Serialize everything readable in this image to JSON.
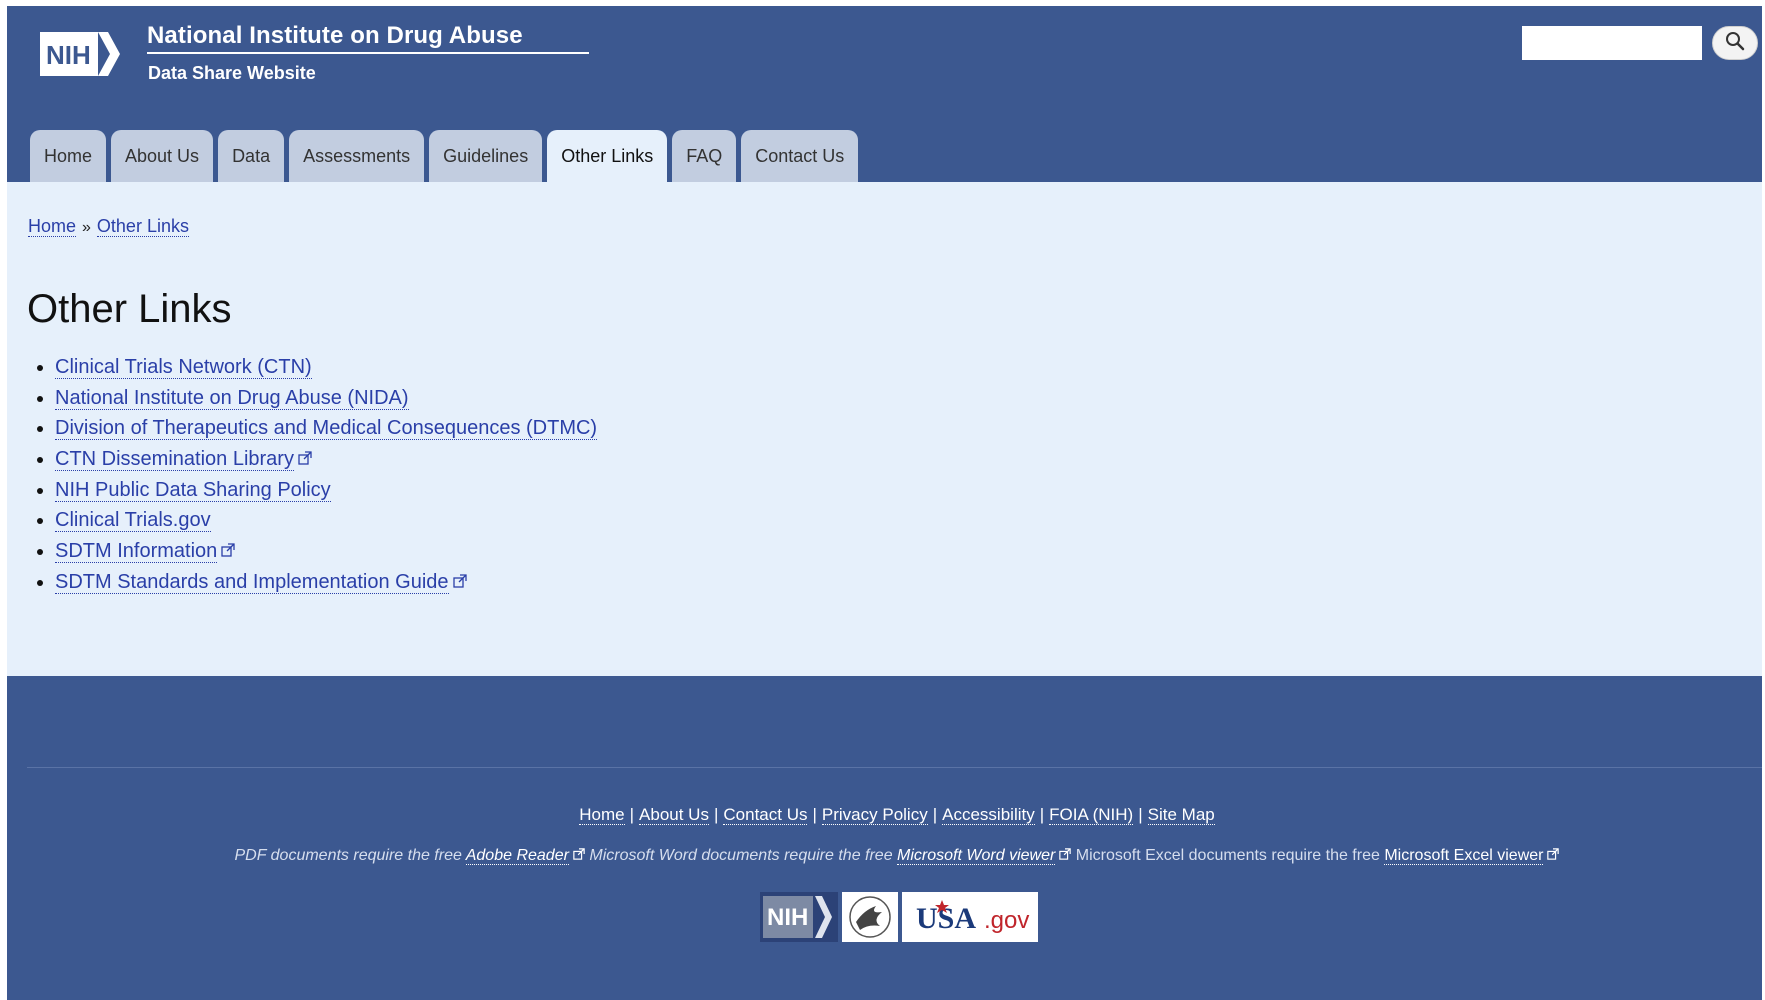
{
  "header": {
    "title": "National Institute on Drug Abuse",
    "subtitle": "Data Share Website",
    "logo_text": "NIH",
    "search": {
      "placeholder": "",
      "button_icon": "search-icon"
    }
  },
  "nav": {
    "tabs": [
      {
        "label": "Home"
      },
      {
        "label": "About Us"
      },
      {
        "label": "Data"
      },
      {
        "label": "Assessments"
      },
      {
        "label": "Guidelines"
      },
      {
        "label": "Other Links",
        "active": true
      },
      {
        "label": "FAQ"
      },
      {
        "label": "Contact Us"
      }
    ]
  },
  "breadcrumb": {
    "home": "Home",
    "separator": "»",
    "current": "Other Links"
  },
  "main": {
    "title": "Other Links",
    "links": [
      {
        "label": "Clinical Trials Network (CTN)",
        "external": false
      },
      {
        "label": "National Institute on Drug Abuse (NIDA)",
        "external": false
      },
      {
        "label": "Division of Therapeutics and Medical Consequences (DTMC)",
        "external": false
      },
      {
        "label": "CTN Dissemination Library",
        "external": true
      },
      {
        "label": "NIH Public Data Sharing Policy",
        "external": false
      },
      {
        "label": "Clinical Trials.gov",
        "external": false
      },
      {
        "label": "SDTM Information",
        "external": true
      },
      {
        "label": "SDTM Standards and Implementation Guide",
        "external": true
      }
    ]
  },
  "footer": {
    "links": [
      "Home",
      "About Us",
      "Contact Us",
      "Privacy Policy",
      "Accessibility",
      "FOIA (NIH)",
      "Site Map"
    ],
    "note": {
      "pdf_text": "PDF documents require the free ",
      "pdf_link": "Adobe Reader",
      "word_text": " Microsoft Word documents require the free ",
      "word_link": "Microsoft Word viewer",
      "excel_text": " Microsoft Excel documents require the free ",
      "excel_link": "Microsoft Excel viewer"
    },
    "logos": {
      "nih": "NIH",
      "hhs": "hhs-eagle-logo",
      "usa": "USA",
      "gov": ".gov"
    }
  },
  "colors": {
    "header_bg": "#3c5890",
    "content_bg": "#e6f0fb",
    "tab_bg": "#c2cde0",
    "link": "#2a3fa8"
  }
}
